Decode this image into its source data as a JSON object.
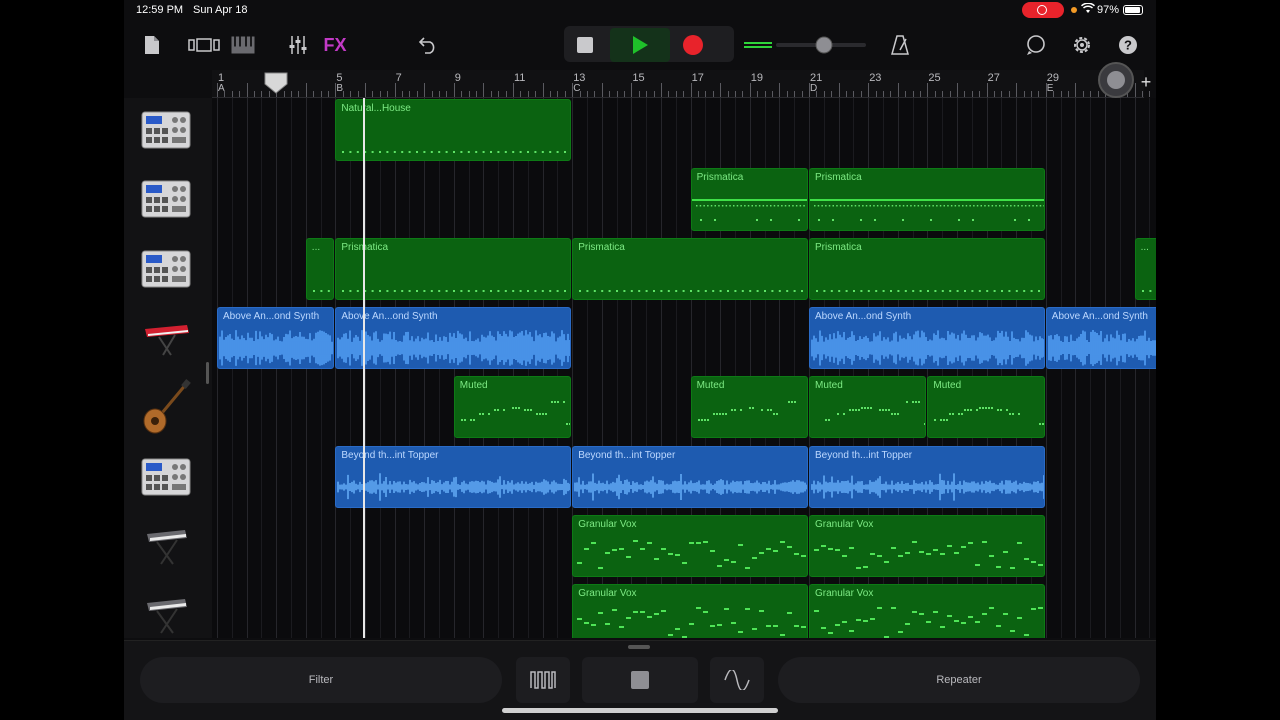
{
  "status_bar": {
    "time": "12:59 PM",
    "date": "Sun Apr 18",
    "battery": "97%"
  },
  "toolbar": {
    "fx_label": "FX"
  },
  "ruler": {
    "bars": [
      "1",
      "3",
      "5",
      "7",
      "9",
      "11",
      "13",
      "15",
      "17",
      "19",
      "21",
      "23",
      "25",
      "27",
      "29",
      "31"
    ],
    "sections": [
      "A",
      "B",
      "C",
      "D",
      "E"
    ]
  },
  "tracks": [
    {
      "instrument": "beat-sequencer-icon",
      "regions": [
        {
          "name": "Natural...House",
          "color": "green"
        }
      ]
    },
    {
      "instrument": "beat-sequencer-icon",
      "regions": [
        {
          "name": "Prismatica",
          "color": "green"
        },
        {
          "name": "Prismatica",
          "color": "green"
        }
      ]
    },
    {
      "instrument": "beat-sequencer-icon",
      "regions": [
        {
          "name": "...",
          "color": "green"
        },
        {
          "name": "Prismatica",
          "color": "green"
        },
        {
          "name": "Prismatica",
          "color": "green"
        },
        {
          "name": "Prismatica",
          "color": "green"
        },
        {
          "name": "...",
          "color": "green"
        }
      ]
    },
    {
      "instrument": "keyboard-synth-icon",
      "regions": [
        {
          "name": "Above An...ond Synth",
          "color": "blue"
        },
        {
          "name": "Above An...ond Synth",
          "color": "blue"
        },
        {
          "name": "Above An...ond Synth",
          "color": "blue"
        },
        {
          "name": "Above An...ond Synth",
          "color": "blue"
        }
      ]
    },
    {
      "instrument": "bass-guitar-icon",
      "regions": [
        {
          "name": "Muted",
          "color": "green"
        },
        {
          "name": "Muted",
          "color": "green"
        },
        {
          "name": "Muted",
          "color": "green"
        },
        {
          "name": "Muted",
          "color": "green"
        }
      ]
    },
    {
      "instrument": "beat-sequencer-icon",
      "regions": [
        {
          "name": "Beyond th...int Topper",
          "color": "blue"
        },
        {
          "name": "Beyond th...int Topper",
          "color": "blue"
        },
        {
          "name": "Beyond th...int Topper",
          "color": "blue"
        }
      ]
    },
    {
      "instrument": "keyboard-stand-icon",
      "regions": [
        {
          "name": "Granular Vox",
          "color": "green"
        },
        {
          "name": "Granular Vox",
          "color": "green"
        }
      ]
    },
    {
      "instrument": "keyboard-stand-icon",
      "regions": [
        {
          "name": "Granular Vox",
          "color": "green"
        },
        {
          "name": "Granular Vox",
          "color": "green"
        }
      ]
    }
  ],
  "bottom": {
    "filter_label": "Filter",
    "repeater_label": "Repeater"
  },
  "colors": {
    "region_green": "#0b6311",
    "region_blue": "#1e5bb0",
    "fx": "#c23ac6",
    "play": "#1fc12a",
    "record": "#e8232b"
  }
}
